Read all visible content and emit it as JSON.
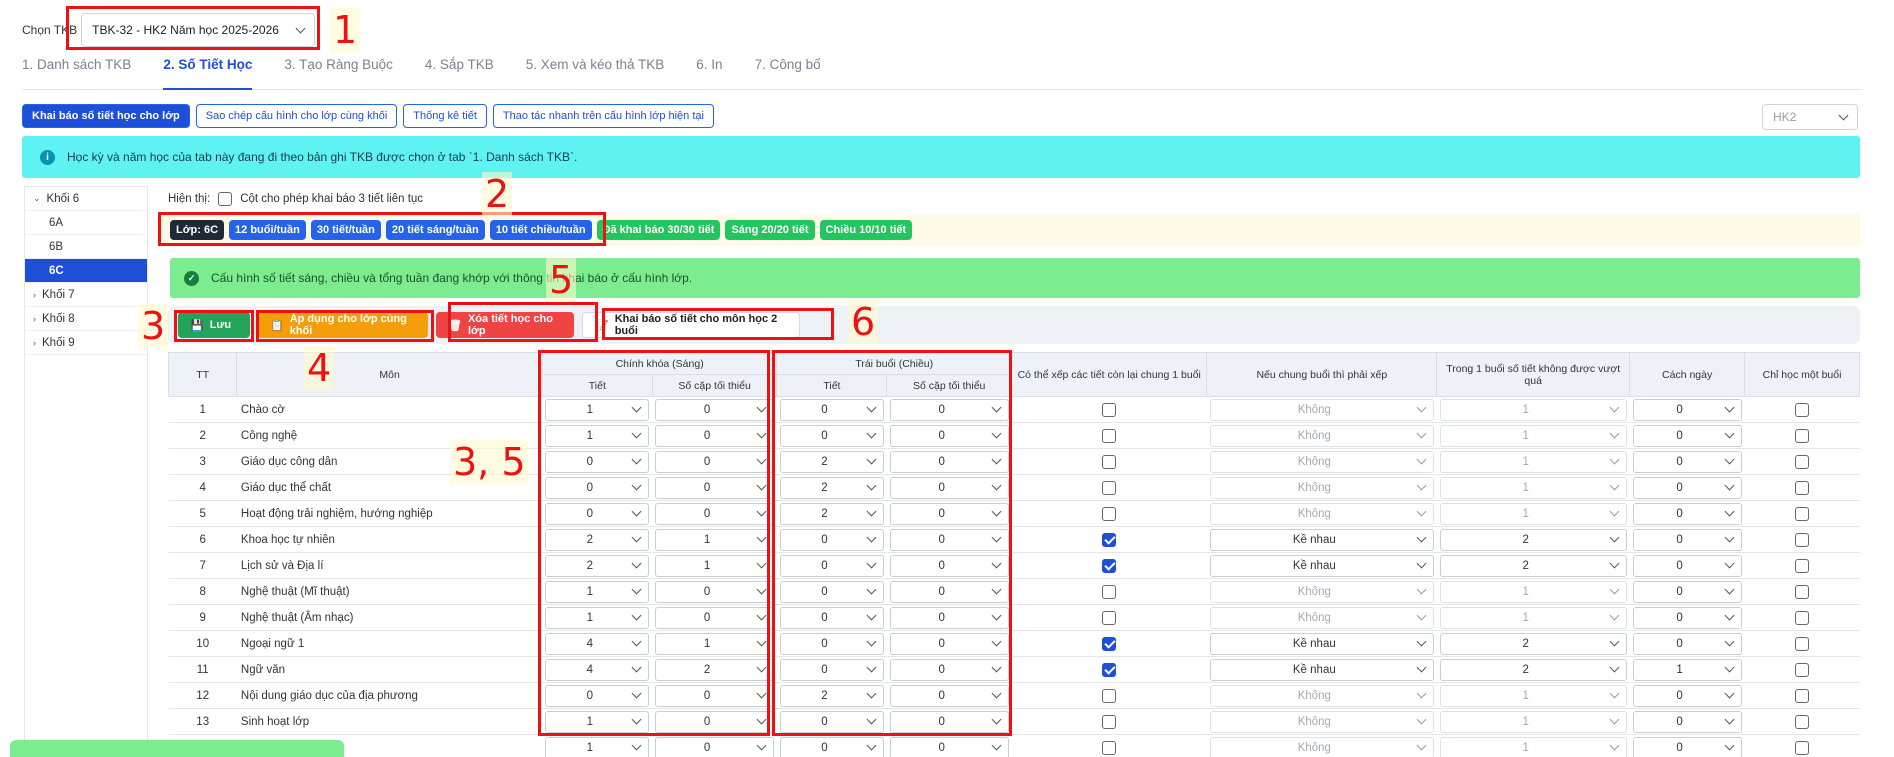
{
  "topbar": {
    "label": "Chọn TKB",
    "selected": "TBK-32 - HK2 Năm học 2025-2026"
  },
  "tabs": [
    "1. Danh sách TKB",
    "2. Số Tiết Học",
    "3. Tạo Ràng Buộc",
    "4. Sắp TKB",
    "5. Xem và kéo thả TKB",
    "6. In",
    "7. Công bố"
  ],
  "subtabs": [
    "Khai báo số tiết học cho lớp",
    "Sao chép cấu hình cho lớp cùng khối",
    "Thống kê tiết",
    "Thao tác nhanh trên cấu hình lớp hiện tại"
  ],
  "semester": "HK2",
  "info_text": "Học kỳ và năm học của tab này đang đi theo bản ghi TKB được chọn ở tab `1. Danh sách TKB`.",
  "sidebar": [
    {
      "label": "Khối 6",
      "type": "group",
      "expanded": true
    },
    {
      "label": "6A",
      "type": "class"
    },
    {
      "label": "6B",
      "type": "class"
    },
    {
      "label": "6C",
      "type": "class",
      "active": true
    },
    {
      "label": "Khối 7",
      "type": "group"
    },
    {
      "label": "Khối 8",
      "type": "group"
    },
    {
      "label": "Khối 9",
      "type": "group"
    }
  ],
  "display": {
    "label": "Hiện thị:",
    "checkbox_label": "Cột cho phép khai báo 3 tiết liên tục"
  },
  "badges": [
    {
      "text": "Lớp: 6C",
      "style": "dark"
    },
    {
      "text": "12 buổi/tuần",
      "style": "blue"
    },
    {
      "text": "30 tiết/tuần",
      "style": "blue"
    },
    {
      "text": "20 tiết sáng/tuần",
      "style": "blue"
    },
    {
      "text": "10 tiết chiều/tuần",
      "style": "blue"
    },
    {
      "text": "Đã khai báo 30/30 tiết",
      "style": "green"
    },
    {
      "text": "Sáng 20/20 tiết",
      "style": "green"
    },
    {
      "text": "Chiều 10/10 tiết",
      "style": "green"
    }
  ],
  "success_text": "Cấu hình số tiết sáng, chiều và tổng tuần đang khớp với thông tin khai báo ở cấu hình lớp.",
  "actions": {
    "save": "Lưu",
    "apply": "Áp dụng cho lớp cùng khối",
    "delete": "Xóa tiết học cho lớp",
    "declare": "Khai báo số tiết cho môn học 2 buổi"
  },
  "table": {
    "headers": {
      "tt": "TT",
      "subject": "Môn",
      "morning": "Chính khóa (Sáng)",
      "afternoon": "Trái buổi (Chiều)",
      "tiet": "Tiết",
      "min_pairs": "Số cặp tối thiểu",
      "can_arrange": "Có thể xếp các tiết còn lại chung 1 buổi",
      "if_shared": "Nếu chung buổi thì phải xếp",
      "no_exceed": "Trong 1 buổi số tiết không được vượt quá",
      "gap_days": "Cách ngày",
      "one_session": "Chỉ học một buổi"
    },
    "rows": [
      {
        "tt": "1",
        "subject": "Chào cờ",
        "m_tiet": "1",
        "m_pairs": "0",
        "a_tiet": "0",
        "a_pairs": "0",
        "can": false,
        "shared": "Không",
        "limit": "1",
        "gap": "0",
        "one": false
      },
      {
        "tt": "2",
        "subject": "Công nghệ",
        "m_tiet": "1",
        "m_pairs": "0",
        "a_tiet": "0",
        "a_pairs": "0",
        "can": false,
        "shared": "Không",
        "limit": "1",
        "gap": "0",
        "one": false
      },
      {
        "tt": "3",
        "subject": "Giáo dục công dân",
        "m_tiet": "0",
        "m_pairs": "0",
        "a_tiet": "2",
        "a_pairs": "0",
        "can": false,
        "shared": "Không",
        "limit": "1",
        "gap": "0",
        "one": false
      },
      {
        "tt": "4",
        "subject": "Giáo dục thể chất",
        "m_tiet": "0",
        "m_pairs": "0",
        "a_tiet": "2",
        "a_pairs": "0",
        "can": false,
        "shared": "Không",
        "limit": "1",
        "gap": "0",
        "one": false
      },
      {
        "tt": "5",
        "subject": "Hoạt động trải nghiệm, hướng nghiệp",
        "m_tiet": "0",
        "m_pairs": "0",
        "a_tiet": "2",
        "a_pairs": "0",
        "can": false,
        "shared": "Không",
        "limit": "1",
        "gap": "0",
        "one": false
      },
      {
        "tt": "6",
        "subject": "Khoa học tự nhiên",
        "m_tiet": "2",
        "m_pairs": "1",
        "a_tiet": "0",
        "a_pairs": "0",
        "can": true,
        "shared": "Kề nhau",
        "limit": "2",
        "gap": "0",
        "one": false
      },
      {
        "tt": "7",
        "subject": "Lịch sử và Địa lí",
        "m_tiet": "2",
        "m_pairs": "1",
        "a_tiet": "0",
        "a_pairs": "0",
        "can": true,
        "shared": "Kề nhau",
        "limit": "2",
        "gap": "0",
        "one": false
      },
      {
        "tt": "8",
        "subject": "Nghệ thuật (Mĩ thuật)",
        "m_tiet": "1",
        "m_pairs": "0",
        "a_tiet": "0",
        "a_pairs": "0",
        "can": false,
        "shared": "Không",
        "limit": "1",
        "gap": "0",
        "one": false
      },
      {
        "tt": "9",
        "subject": "Nghệ thuật (Âm nhạc)",
        "m_tiet": "1",
        "m_pairs": "0",
        "a_tiet": "0",
        "a_pairs": "0",
        "can": false,
        "shared": "Không",
        "limit": "1",
        "gap": "0",
        "one": false
      },
      {
        "tt": "10",
        "subject": "Ngoại ngữ 1",
        "m_tiet": "4",
        "m_pairs": "1",
        "a_tiet": "0",
        "a_pairs": "0",
        "can": true,
        "shared": "Kề nhau",
        "limit": "2",
        "gap": "0",
        "one": false
      },
      {
        "tt": "11",
        "subject": "Ngữ văn",
        "m_tiet": "4",
        "m_pairs": "2",
        "a_tiet": "0",
        "a_pairs": "0",
        "can": true,
        "shared": "Kề nhau",
        "limit": "2",
        "gap": "1",
        "one": false
      },
      {
        "tt": "12",
        "subject": "Nội dung giáo dục của địa phương",
        "m_tiet": "0",
        "m_pairs": "0",
        "a_tiet": "2",
        "a_pairs": "0",
        "can": false,
        "shared": "Không",
        "limit": "1",
        "gap": "0",
        "one": false
      },
      {
        "tt": "13",
        "subject": "Sinh hoạt lớp",
        "m_tiet": "1",
        "m_pairs": "0",
        "a_tiet": "0",
        "a_pairs": "0",
        "can": false,
        "shared": "Không",
        "limit": "1",
        "gap": "0",
        "one": false
      },
      {
        "tt": "",
        "subject": "",
        "m_tiet": "1",
        "m_pairs": "0",
        "a_tiet": "0",
        "a_pairs": "0",
        "can": false,
        "shared": "Không",
        "limit": "1",
        "gap": "0",
        "one": false
      }
    ]
  },
  "annotations": {
    "n1": "1",
    "n2": "2",
    "n3": "3",
    "n4": "4",
    "n5": "5",
    "n6": "6",
    "n35": "3, 5"
  },
  "colors": {
    "accent": "#1d4fd8",
    "info": "#5ef2f2",
    "success": "#7ced8e",
    "annotation": "#ee1111"
  }
}
